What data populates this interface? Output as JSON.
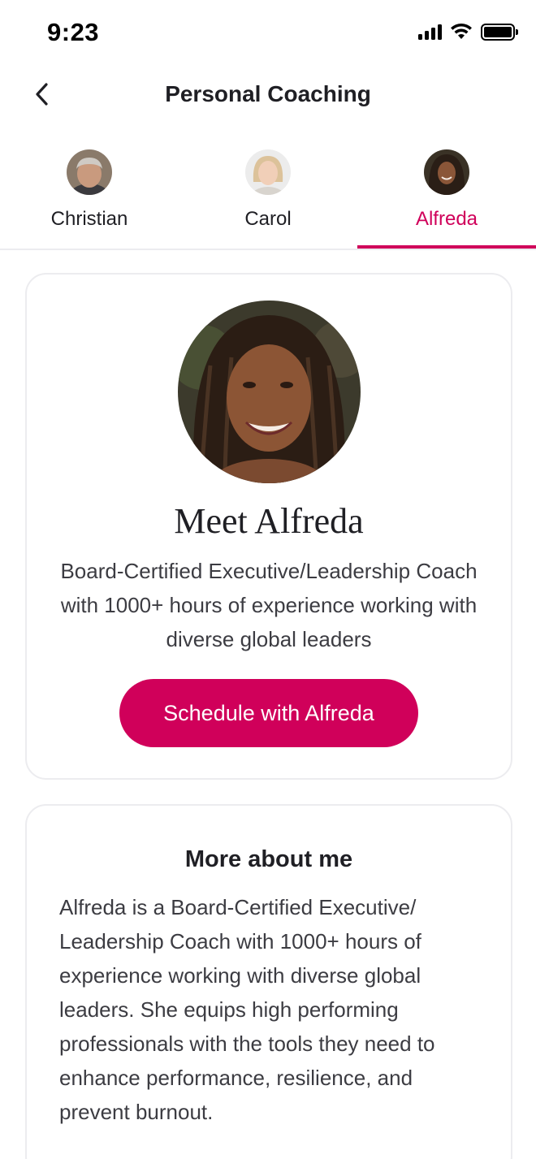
{
  "status_bar": {
    "time": "9:23"
  },
  "header": {
    "title": "Personal Coaching",
    "back_icon": "chevron-left-icon"
  },
  "coaches": [
    {
      "name": "Christian",
      "active": false
    },
    {
      "name": "Carol",
      "active": false
    },
    {
      "name": "Alfreda",
      "active": true
    }
  ],
  "profile": {
    "heading": "Meet Alfreda",
    "description": "Board-Certified Executive/Leadership Coach with 1000+ hours of experience working with diverse global leaders",
    "cta_label": "Schedule with Alfreda"
  },
  "about": {
    "heading": "More about me",
    "text": "Alfreda is a Board-Certified Executive/ Leadership Coach with 1000+ hours of experience working with diverse global leaders. She equips high performing professionals with the tools they need to enhance performance, resilience, and prevent burnout."
  },
  "colors": {
    "accent": "#d0005a",
    "text_primary": "#1f1f24",
    "text_secondary": "#3c3c42",
    "border": "#ececef"
  }
}
